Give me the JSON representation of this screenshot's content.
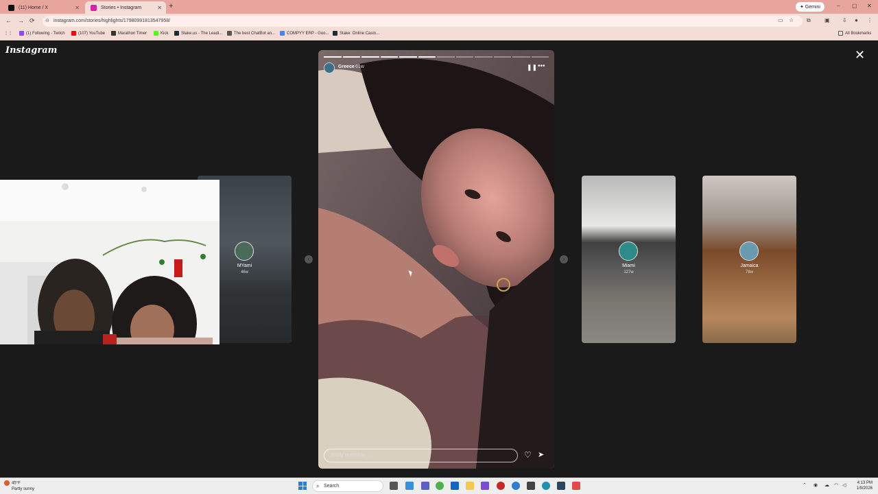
{
  "browser": {
    "tabs": [
      {
        "label": "(11) Home / X",
        "favicon_color": "#111111",
        "active": false
      },
      {
        "label": "Stories • Instagram",
        "favicon_color": "#d6249f",
        "active": true
      }
    ],
    "new_tab": "+",
    "gemini_label": "✦ Gemini",
    "window_controls": [
      "–",
      "▢",
      "✕"
    ],
    "nav": {
      "back": "←",
      "forward": "→",
      "reload": "⟳"
    },
    "url": "instagram.com/stories/highlights/17980991813547958/",
    "url_lock": "⊝",
    "bookmarks": [
      {
        "label": "(1) Following - Twitch",
        "color": "#9146ff"
      },
      {
        "label": "(107) YouTube",
        "color": "#ff0000"
      },
      {
        "label": "Marathon Timer",
        "color": "#333333"
      },
      {
        "label": "Kick",
        "color": "#53fc18"
      },
      {
        "label": "Stake.us - The Leadi...",
        "color": "#1a2c38"
      },
      {
        "label": "The best ChatBot an...",
        "color": "#555555"
      },
      {
        "label": "COMPYY ERP - Goo...",
        "color": "#4285f4"
      },
      {
        "label": "Stake: Online Casin...",
        "color": "#1a2c38"
      }
    ],
    "all_bookmarks": "All Bookmarks"
  },
  "instagram": {
    "logo": "Instagram",
    "close": "✕",
    "main_story": {
      "username": "Greece",
      "age": "61w",
      "progress_total": 12,
      "progress_done": 6,
      "pause_icon": "❚❚",
      "more_icon": "•••",
      "reply_placeholder": "Reply to ucshay_...",
      "heart_icon": "♡",
      "send_icon": "➤"
    },
    "prev_arrow": "‹",
    "next_arrow": "›",
    "side_stories": [
      {
        "label": "MYami",
        "age": "46w"
      },
      {
        "label": "Miami",
        "age": "127w"
      },
      {
        "label": "Jamaica",
        "age": "78w"
      }
    ]
  },
  "taskbar": {
    "weather_temp": "45°F",
    "weather_desc": "Partly sunny",
    "search_label": "Search",
    "time": "4:13 PM",
    "date": "1/9/2026"
  }
}
